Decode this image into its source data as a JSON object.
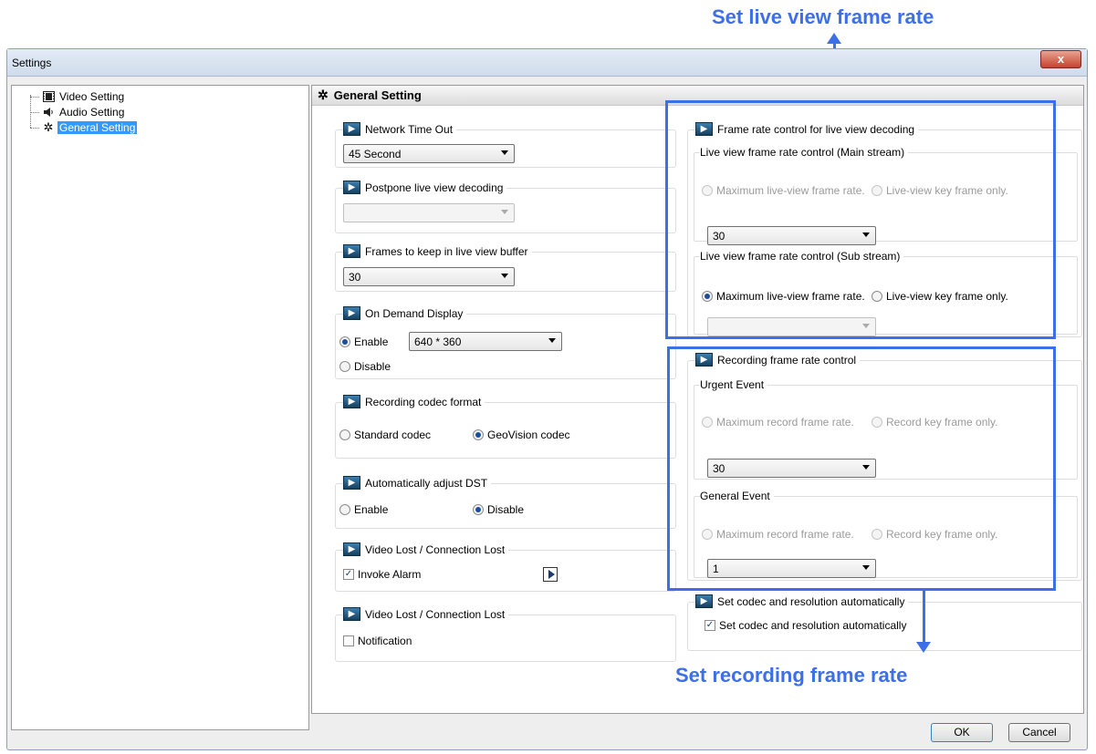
{
  "annotations": {
    "top": "Set live view frame rate",
    "bottom": "Set recording frame rate"
  },
  "window": {
    "title": "Settings",
    "close_label": "x"
  },
  "tree": {
    "items": [
      {
        "label": "Video Setting",
        "icon": "film-icon"
      },
      {
        "label": "Audio Setting",
        "icon": "speaker-icon"
      },
      {
        "label": "General Setting",
        "icon": "gear-icon",
        "selected": true
      }
    ]
  },
  "main": {
    "header": "General Setting",
    "network_timeout": {
      "title": "Network Time Out",
      "value": "45 Second"
    },
    "postpone": {
      "title": "Postpone live view decoding",
      "value": ""
    },
    "frames_buffer": {
      "title": "Frames to keep in live view buffer",
      "value": "30"
    },
    "on_demand": {
      "title": "On Demand Display",
      "enable": "Enable",
      "disable": "Disable",
      "resolution": "640 * 360",
      "selected": "enable"
    },
    "codec_format": {
      "title": "Recording codec format",
      "standard": "Standard codec",
      "geovision": "GeoVision codec",
      "selected": "geovision"
    },
    "dst": {
      "title": "Automatically adjust DST",
      "enable": "Enable",
      "disable": "Disable",
      "selected": "disable"
    },
    "video_lost_alarm": {
      "title": "Video Lost / Connection Lost",
      "invoke": "Invoke Alarm",
      "checked": true
    },
    "video_lost_notify": {
      "title": "Video Lost / Connection Lost",
      "notification": "Notification",
      "checked": false
    },
    "live_frame": {
      "title": "Frame rate control for live view decoding",
      "main": {
        "title": "Live view frame rate control (Main stream)",
        "max": "Maximum live-view frame rate.",
        "key": "Live-view key frame only.",
        "value": "30"
      },
      "sub": {
        "title": "Live view frame rate control (Sub stream)",
        "max": "Maximum live-view frame rate.",
        "key": "Live-view key frame only.",
        "value": ""
      }
    },
    "rec_frame": {
      "title": "Recording frame rate control",
      "urgent": {
        "title": "Urgent Event",
        "max": "Maximum record frame rate.",
        "key": "Record key frame only.",
        "value": "30"
      },
      "general": {
        "title": "General Event",
        "max": "Maximum record frame rate.",
        "key": "Record key frame only.",
        "value": "1"
      }
    },
    "codec_auto": {
      "title": "Set codec and resolution automatically",
      "label": "Set codec and resolution automatically",
      "checked": true
    }
  },
  "buttons": {
    "ok": "OK",
    "cancel": "Cancel"
  },
  "colors": {
    "annotation": "#3d6fe8",
    "selection": "#3399ff"
  }
}
